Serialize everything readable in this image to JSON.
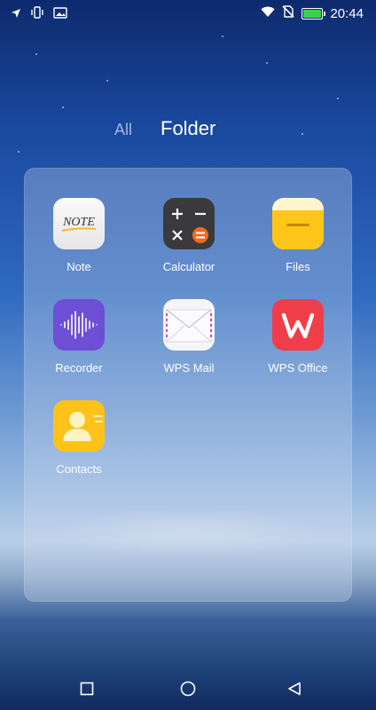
{
  "status_bar": {
    "time": "20:44",
    "left_icons": [
      "location-arrow-icon",
      "vibrate-icon",
      "image-icon"
    ],
    "right_icons": [
      "wifi-icon",
      "no-sim-icon",
      "battery-charging-icon"
    ],
    "battery_color": "#38d34a"
  },
  "header": {
    "tab_all": "All",
    "tab_folder": "Folder"
  },
  "folder": {
    "apps": [
      {
        "label": "Note",
        "icon": "note-icon"
      },
      {
        "label": "Calculator",
        "icon": "calculator-icon"
      },
      {
        "label": "Files",
        "icon": "files-icon"
      },
      {
        "label": "Recorder",
        "icon": "recorder-icon"
      },
      {
        "label": "WPS Mail",
        "icon": "mail-icon"
      },
      {
        "label": "WPS Office",
        "icon": "wps-office-icon"
      },
      {
        "label": "Contacts",
        "icon": "contacts-icon"
      }
    ],
    "note_icon_text": "NOTE"
  },
  "nav_bar": {
    "buttons": [
      "recents-square-icon",
      "home-circle-icon",
      "back-triangle-icon"
    ]
  },
  "colors": {
    "calculator_accent": "#f26a1b",
    "files_yellow": "#ffc61a",
    "recorder_purple": "#6c4fd4",
    "wps_red": "#ef3e4a",
    "contacts_yellow": "#ffc21a"
  }
}
